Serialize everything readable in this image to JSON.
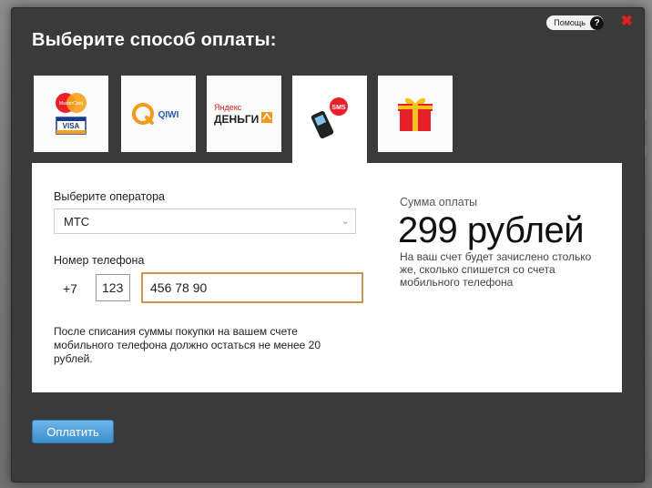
{
  "dialog": {
    "title": "Выберите способ оплаты:",
    "help_label": "Помощь",
    "help_icon_glyph": "?",
    "close_glyph": "✖"
  },
  "tabs": [
    {
      "id": "card",
      "icon": "mastercard-visa-icon",
      "caption_top": "MasterCard",
      "caption_bottom": "VISA"
    },
    {
      "id": "qiwi",
      "icon": "qiwi-icon",
      "caption": "QIWI"
    },
    {
      "id": "yandex",
      "icon": "yandex-money-icon",
      "caption_top": "Яндекс",
      "caption_bottom": "ДЕНЬГИ"
    },
    {
      "id": "sms",
      "icon": "mobile-sms-icon",
      "caption": "SMS",
      "active": true
    },
    {
      "id": "gift",
      "icon": "gift-icon"
    }
  ],
  "form": {
    "operator_label": "Выберите оператора",
    "operator_value": "МТС",
    "phone_label": "Номер телефона",
    "phone_prefix": "+7",
    "phone_code": "123",
    "phone_number": "456 78 90",
    "note": "После списания суммы покупки на вашем счете мобильного телефона должно остаться не менее 20 рублей."
  },
  "summary": {
    "label": "Сумма оплаты",
    "amount": "299 рублей",
    "note": "На ваш счет будет зачислено столько же, сколько спишется со счета мобильного телефона"
  },
  "actions": {
    "pay_label": "Оплатить"
  },
  "colors": {
    "accent_blue": "#3b8fd0",
    "input_focus": "#c59a52",
    "close_red": "#e02020",
    "dialog_bg": "#3a3a3a"
  }
}
